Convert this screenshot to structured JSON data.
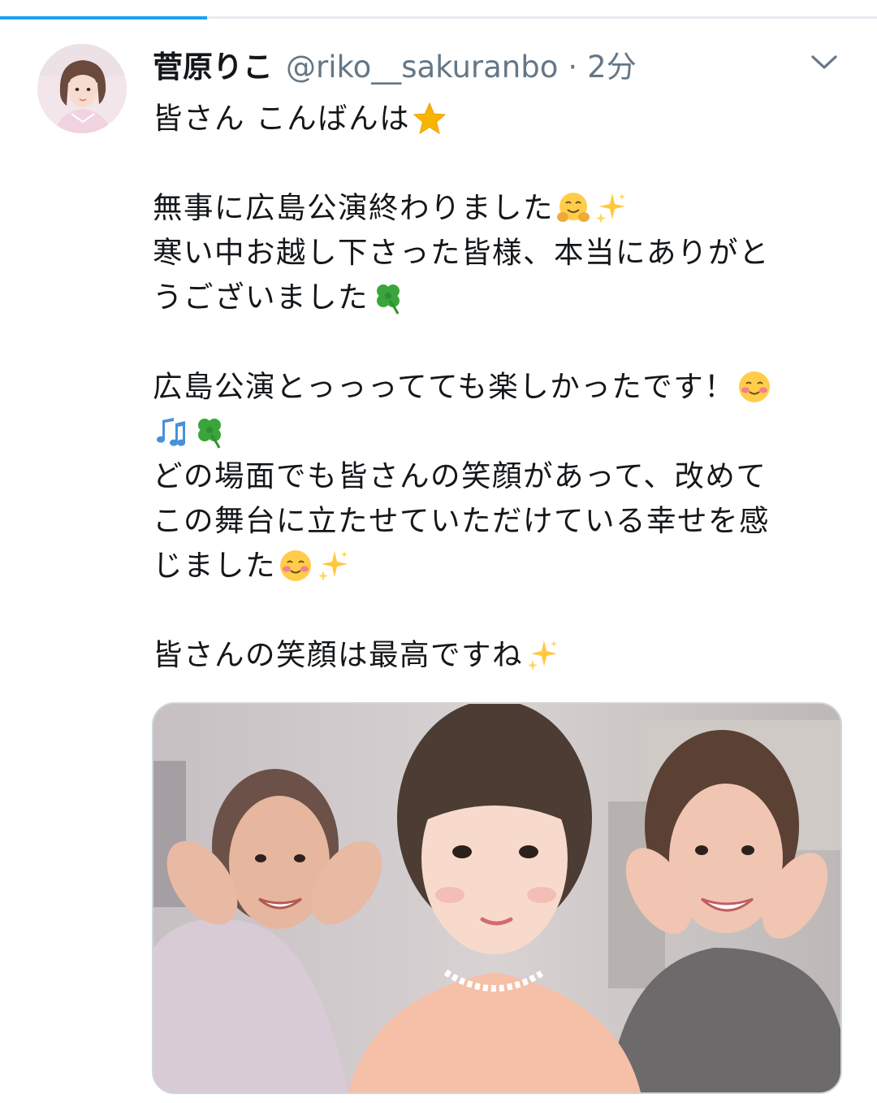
{
  "tweet": {
    "display_name": "菅原りこ",
    "handle": "@riko__sakuranbo",
    "separator": "·",
    "time": "2分",
    "lines": [
      {
        "text": "皆さん こんばんは",
        "emojis": [
          "star"
        ]
      },
      {
        "blank": true
      },
      {
        "text": "無事に広島公演終わりました",
        "emojis": [
          "hugging",
          "sparkles"
        ]
      },
      {
        "text": "寒い中お越し下さった皆様、本当にありがと",
        "emojis": []
      },
      {
        "text": "うございました",
        "emojis": [
          "clover"
        ]
      },
      {
        "blank": true
      },
      {
        "text": "広島公演とっっってても楽しかったです！",
        "emojis": [
          "smiling-blush"
        ]
      },
      {
        "text": "",
        "emojis": [
          "notes",
          "clover"
        ]
      },
      {
        "text": "どの場面でも皆さんの笑顔があって、改めて",
        "emojis": []
      },
      {
        "text": "この舞台に立たせていただけている幸せを感",
        "emojis": []
      },
      {
        "text": "じました",
        "emojis": [
          "smiling-blush",
          "sparkles"
        ]
      },
      {
        "blank": true
      },
      {
        "text": "皆さんの笑顔は最高ですね",
        "emojis": [
          "sparkles"
        ]
      }
    ]
  },
  "icons": {
    "caret": "chevron-down-icon",
    "star": "star-icon",
    "hugging": "hugging-face-icon",
    "sparkles": "sparkles-icon",
    "clover": "four-leaf-clover-icon",
    "smiling-blush": "smiling-blush-face-icon",
    "notes": "musical-notes-icon"
  },
  "colors": {
    "accent": "#1da1f2",
    "text_primary": "#14171a",
    "text_secondary": "#657786",
    "border": "#ccd6dd"
  }
}
